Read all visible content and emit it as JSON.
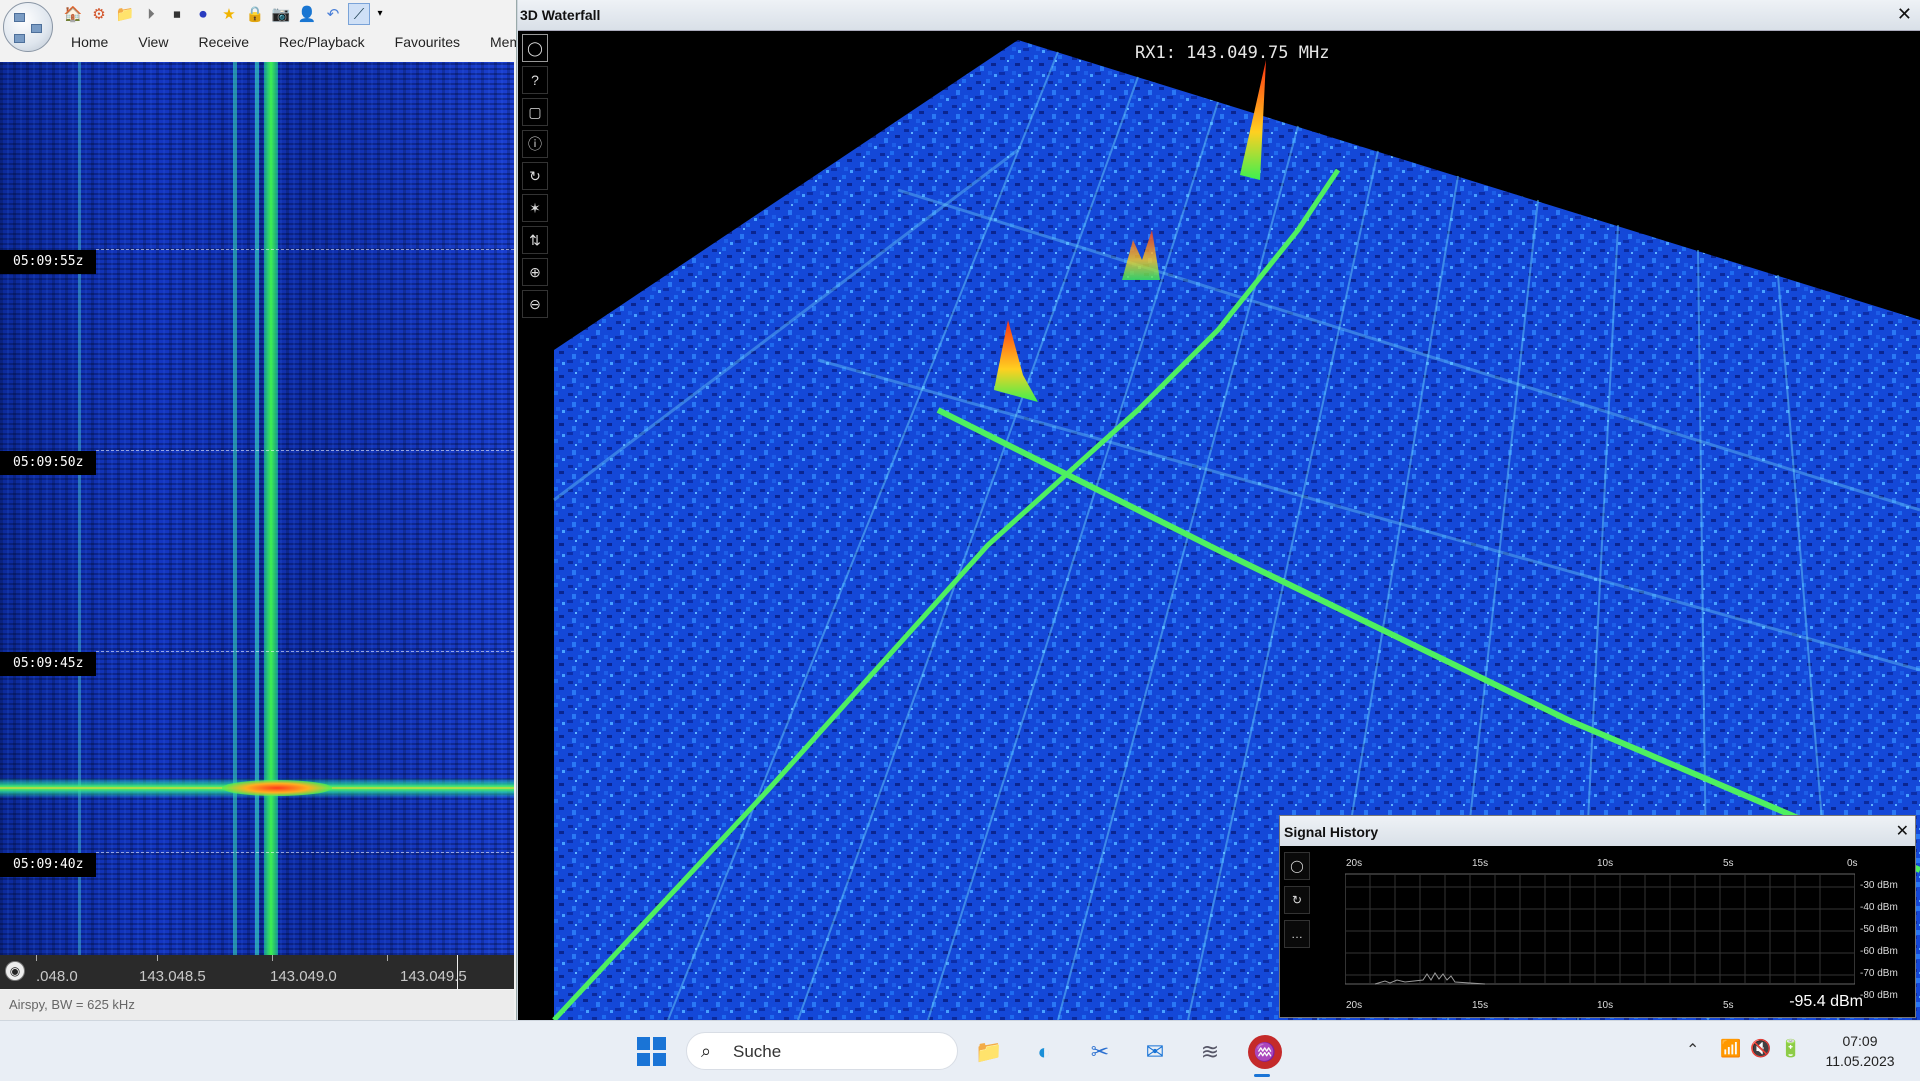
{
  "left_app": {
    "quick_access_icons": [
      "home-icon",
      "settings-wheel-icon",
      "folder-icon",
      "play-icon",
      "stop-icon",
      "record-icon",
      "star-icon",
      "lock-icon",
      "camera-icon",
      "user-icon",
      "undo-icon",
      "line-tool-icon",
      "dropdown-arrow-icon"
    ],
    "ribbon_tabs": [
      "Home",
      "View",
      "Receive",
      "Rec/Playback",
      "Favourites",
      "Memor"
    ],
    "waterfall": {
      "time_labels": [
        "05:09:55z",
        "05:09:50z",
        "05:09:45z",
        "05:09:40z"
      ]
    },
    "frequency_scale": {
      "labels": [
        ".048.0",
        "143.048.5",
        "143.049.0",
        "143.049.5"
      ]
    },
    "status": "Airspy, BW = 625 kHz"
  },
  "waterfall_3d": {
    "title": "3D Waterfall",
    "close_glyph": "✕",
    "rx_label": "RX1: 143.049.75 MHz",
    "toolbar": [
      {
        "name": "display-mode-icon",
        "glyph": "◯"
      },
      {
        "name": "help-icon",
        "glyph": "?"
      },
      {
        "name": "window-icon",
        "glyph": "▢"
      },
      {
        "name": "info-icon",
        "glyph": "ⓘ"
      },
      {
        "name": "reset-rotation-icon",
        "glyph": "↻"
      },
      {
        "name": "brightness-icon",
        "glyph": "✶"
      },
      {
        "name": "swap-vertical-icon",
        "glyph": "⇅"
      },
      {
        "name": "zoom-in-icon",
        "glyph": "⊕"
      },
      {
        "name": "zoom-out-icon",
        "glyph": "⊖"
      }
    ]
  },
  "signal_history": {
    "title": "Signal History",
    "close_glyph": "✕",
    "tools": [
      {
        "name": "display-mode-icon",
        "glyph": "◯"
      },
      {
        "name": "reset-icon",
        "glyph": "↻"
      },
      {
        "name": "more-icon",
        "glyph": "…"
      }
    ],
    "time_labels": [
      "20s",
      "15s",
      "10s",
      "5s",
      "0s"
    ],
    "level_labels": [
      "-30 dBm",
      "-40 dBm",
      "-50 dBm",
      "-60 dBm",
      "-70 dBm",
      "-80 dBm"
    ],
    "current_level": "-95.4 dBm"
  },
  "taskbar": {
    "search_placeholder": "Suche",
    "apps": [
      "file-explorer-icon",
      "edge-browser-icon",
      "snipping-tool-icon",
      "mail-icon",
      "sdr-app-icon",
      "radio-app-icon"
    ],
    "tray": [
      "wifi-icon",
      "speaker-muted-icon",
      "battery-icon"
    ],
    "time": "07:09",
    "date": "11.05.2023"
  }
}
